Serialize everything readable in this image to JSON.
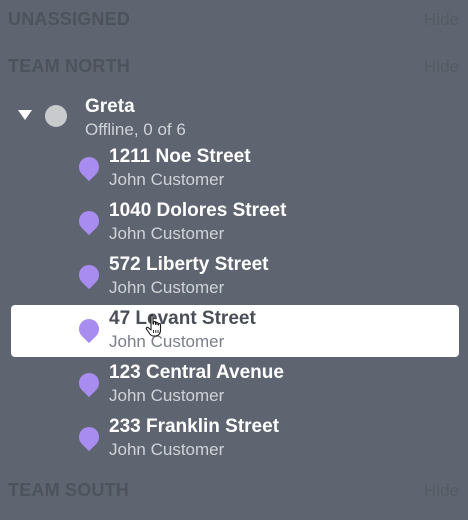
{
  "sections": {
    "unassigned": {
      "title": "UNASSIGNED",
      "hide_label": "Hide"
    },
    "team_north": {
      "title": "TEAM NORTH",
      "hide_label": "Hide"
    },
    "team_south": {
      "title": "TEAM SOUTH",
      "hide_label": "Hide"
    }
  },
  "driver": {
    "name": "Greta",
    "status": "Offline, 0 of 6",
    "status_color": "#c9cace"
  },
  "tasks": [
    {
      "address": "1211 Noe Street",
      "customer": "John Customer"
    },
    {
      "address": "1040 Dolores Street",
      "customer": "John Customer"
    },
    {
      "address": "572 Liberty Street",
      "customer": "John Customer"
    },
    {
      "address": "47 Levant Street",
      "customer": "John Customer"
    },
    {
      "address": "123 Central Avenue",
      "customer": "John Customer"
    },
    {
      "address": "233 Franklin Street",
      "customer": "John Customer"
    }
  ],
  "colors": {
    "background": "#5f6570",
    "pin": "#a98cf0",
    "selected_row": "#ffffff"
  },
  "icons": {
    "expand": "caret-down-icon",
    "pin": "map-pin-icon",
    "cursor": "hand-cursor-icon"
  }
}
